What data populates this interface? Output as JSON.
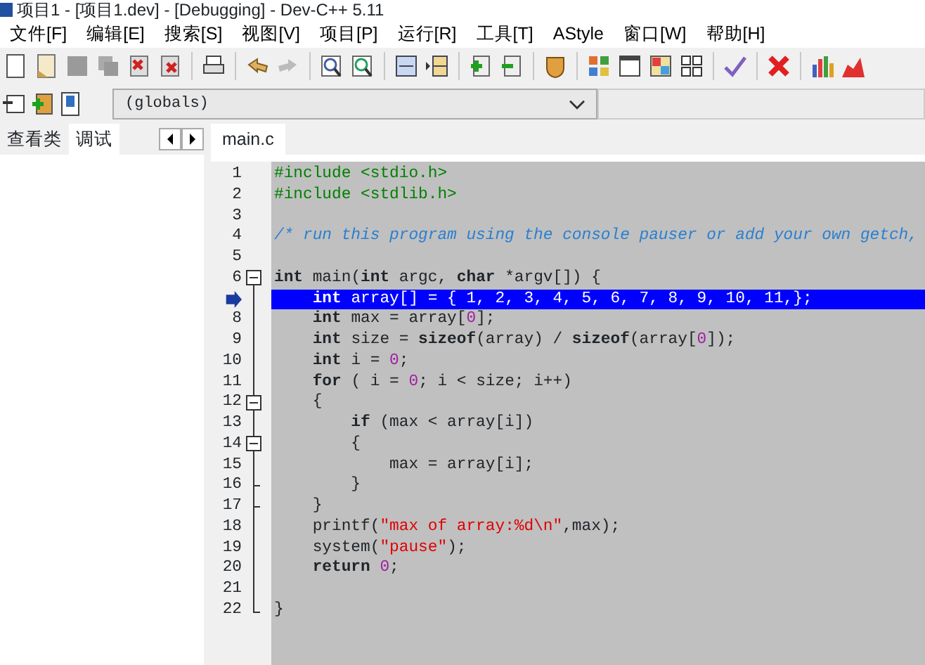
{
  "window": {
    "title": "项目1 - [项目1.dev] - [Debugging] - Dev-C++ 5.11"
  },
  "menu": [
    "文件[F]",
    "编辑[E]",
    "搜索[S]",
    "视图[V]",
    "项目[P]",
    "运行[R]",
    "工具[T]",
    "AStyle",
    "窗口[W]",
    "帮助[H]"
  ],
  "scope_combo": {
    "value": "(globals)"
  },
  "left_tabs": [
    {
      "label": "查看类",
      "selected": false
    },
    {
      "label": "调试",
      "selected": true
    }
  ],
  "editor_tabs": [
    {
      "label": "main.c",
      "selected": true
    }
  ],
  "lines": [
    {
      "number": "1",
      "kind": "plain",
      "current": false,
      "tokens": [
        {
          "kind": "directive",
          "text": "#include <stdio.h>"
        }
      ]
    },
    {
      "number": "2",
      "kind": "plain",
      "current": false,
      "tokens": [
        {
          "kind": "directive",
          "text": "#include <stdlib.h>"
        }
      ]
    },
    {
      "number": "3",
      "kind": "plain",
      "current": false
    },
    {
      "number": "4",
      "kind": "plain",
      "current": false,
      "tokens": [
        {
          "kind": "comment",
          "text": "/* run this program using the console pauser or add your own getch,"
        }
      ]
    },
    {
      "number": "5",
      "kind": "plain",
      "current": false
    },
    {
      "number": "6",
      "kind": "open",
      "current": false,
      "tokens": [
        {
          "kind": "keyword",
          "text": "int"
        },
        {
          "kind": "plain",
          "text": " main("
        },
        {
          "kind": "keyword",
          "text": "int"
        },
        {
          "kind": "plain",
          "text": " argc, "
        },
        {
          "kind": "keyword",
          "text": "char"
        },
        {
          "kind": "plain",
          "text": " *argv[]) {"
        }
      ]
    },
    {
      "kind": "body",
      "current": true,
      "tokens": [
        {
          "kind": "keyword",
          "text": "    int"
        },
        {
          "kind": "plain",
          "text": " array[] = { 1, 2, 3, 4, 5, 6, 7, 8, 9, 10, 11,};"
        }
      ]
    },
    {
      "number": "8",
      "kind": "body",
      "current": false,
      "tokens": [
        {
          "kind": "keyword",
          "text": "    int"
        },
        {
          "kind": "plain",
          "text": " max = array["
        },
        {
          "kind": "number",
          "text": "0"
        },
        {
          "kind": "plain",
          "text": "];"
        }
      ]
    },
    {
      "number": "9",
      "kind": "body",
      "current": false,
      "tokens": [
        {
          "kind": "keyword",
          "text": "    int"
        },
        {
          "kind": "plain",
          "text": " size = "
        },
        {
          "kind": "keyword",
          "text": "sizeof"
        },
        {
          "kind": "plain",
          "text": "(array) / "
        },
        {
          "kind": "keyword",
          "text": "sizeof"
        },
        {
          "kind": "plain",
          "text": "(array["
        },
        {
          "kind": "number",
          "text": "0"
        },
        {
          "kind": "plain",
          "text": "]);"
        }
      ]
    },
    {
      "number": "10",
      "kind": "body",
      "current": false,
      "tokens": [
        {
          "kind": "keyword",
          "text": "    int"
        },
        {
          "kind": "plain",
          "text": " i = "
        },
        {
          "kind": "number",
          "text": "0"
        },
        {
          "kind": "plain",
          "text": ";"
        }
      ]
    },
    {
      "number": "11",
      "kind": "body",
      "current": false,
      "tokens": [
        {
          "kind": "keyword",
          "text": "    for"
        },
        {
          "kind": "plain",
          "text": " ( i = "
        },
        {
          "kind": "number",
          "text": "0"
        },
        {
          "kind": "plain",
          "text": "; i < size; i++)"
        }
      ]
    },
    {
      "number": "12",
      "kind": "open",
      "current": false,
      "tokens": [
        {
          "kind": "plain",
          "text": "    {"
        }
      ]
    },
    {
      "number": "13",
      "kind": "body",
      "current": false,
      "tokens": [
        {
          "kind": "keyword",
          "text": "        if"
        },
        {
          "kind": "plain",
          "text": " (max < array[i])"
        }
      ]
    },
    {
      "number": "14",
      "kind": "open",
      "current": false,
      "tokens": [
        {
          "kind": "plain",
          "text": "        {"
        }
      ]
    },
    {
      "number": "15",
      "kind": "body",
      "current": false,
      "tokens": [
        {
          "kind": "plain",
          "text": "            max = array[i];"
        }
      ]
    },
    {
      "number": "16",
      "kind": "branch",
      "current": false,
      "tokens": [
        {
          "kind": "plain",
          "text": "        }"
        }
      ]
    },
    {
      "number": "17",
      "kind": "branch",
      "current": false,
      "tokens": [
        {
          "kind": "plain",
          "text": "    }"
        }
      ]
    },
    {
      "number": "18",
      "kind": "body",
      "current": false,
      "tokens": [
        {
          "kind": "plain",
          "text": "    printf("
        },
        {
          "kind": "string",
          "text": "\"max of array:%d\\n\""
        },
        {
          "kind": "plain",
          "text": ",max);"
        }
      ]
    },
    {
      "number": "19",
      "kind": "body",
      "current": false,
      "tokens": [
        {
          "kind": "plain",
          "text": "    system("
        },
        {
          "kind": "string",
          "text": "\"pause\""
        },
        {
          "kind": "plain",
          "text": ");"
        }
      ]
    },
    {
      "number": "20",
      "kind": "body",
      "current": false,
      "tokens": [
        {
          "kind": "keyword",
          "text": "    return "
        },
        {
          "kind": "number",
          "text": "0"
        },
        {
          "kind": "plain",
          "text": ";"
        }
      ]
    },
    {
      "number": "21",
      "kind": "body",
      "current": false
    },
    {
      "number": "22",
      "kind": "close",
      "current": false,
      "tokens": [
        {
          "kind": "plain",
          "text": "}"
        }
      ]
    }
  ]
}
